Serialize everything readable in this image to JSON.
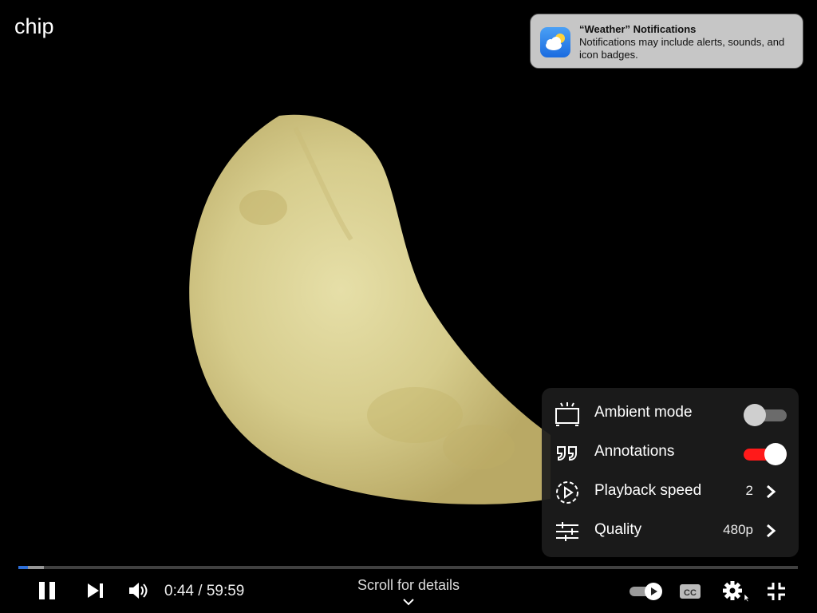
{
  "video": {
    "title": "chip"
  },
  "notification": {
    "title": "“Weather” Notifications",
    "body": "Notifications may include alerts, sounds, and icon badges.",
    "icon": "weather-app-icon"
  },
  "settings_menu": {
    "items": [
      {
        "icon": "ambient-mode-icon",
        "label": "Ambient mode",
        "control": "toggle",
        "enabled": false
      },
      {
        "icon": "annotations-icon",
        "label": "Annotations",
        "control": "toggle",
        "enabled": true
      },
      {
        "icon": "playback-speed-icon",
        "label": "Playback speed",
        "value": "2",
        "control": "submenu"
      },
      {
        "icon": "quality-icon",
        "label": "Quality",
        "value": "480p",
        "control": "submenu"
      }
    ]
  },
  "player": {
    "current_time": "0:44",
    "duration": "59:59",
    "time_display": "0:44 / 59:59",
    "scroll_hint": "Scroll for details",
    "progress_played_fraction": 0.012,
    "progress_loaded_fraction": 0.033
  },
  "colors": {
    "toggle_on": "#ff1a1a",
    "progress_played": "#2e6fd8",
    "menu_background": "#1c1c1c"
  }
}
